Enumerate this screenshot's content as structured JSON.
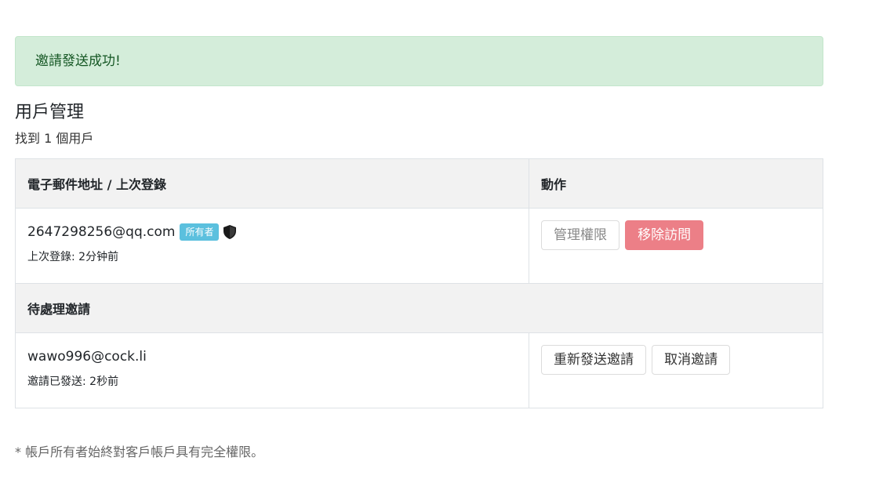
{
  "alert": {
    "message": "邀請發送成功!"
  },
  "page": {
    "title": "用戶管理",
    "user_count": "找到 1 個用戶"
  },
  "table": {
    "headers": {
      "email": "電子郵件地址 / 上次登錄",
      "actions": "動作"
    },
    "users": [
      {
        "email": "2647298256@qq.com",
        "badge": "所有者",
        "last_login": "上次登錄: 2分钟前",
        "actions": {
          "manage": "管理權限",
          "remove": "移除訪問"
        }
      }
    ],
    "pending_section_title": "待處理邀請",
    "invites": [
      {
        "email": "wawo996@cock.li",
        "sent": "邀請已發送: 2秒前",
        "actions": {
          "resend": "重新發送邀請",
          "cancel": "取消邀請"
        }
      }
    ]
  },
  "footnote": "* 帳戶所有者始終對客戶帳戶具有完全權限。",
  "colors": {
    "alert_bg": "#d4edda",
    "alert_text": "#155724",
    "badge_bg": "#5bc0de",
    "danger_bg": "#ec7f87"
  },
  "icons": {
    "owner": "shield-icon"
  }
}
